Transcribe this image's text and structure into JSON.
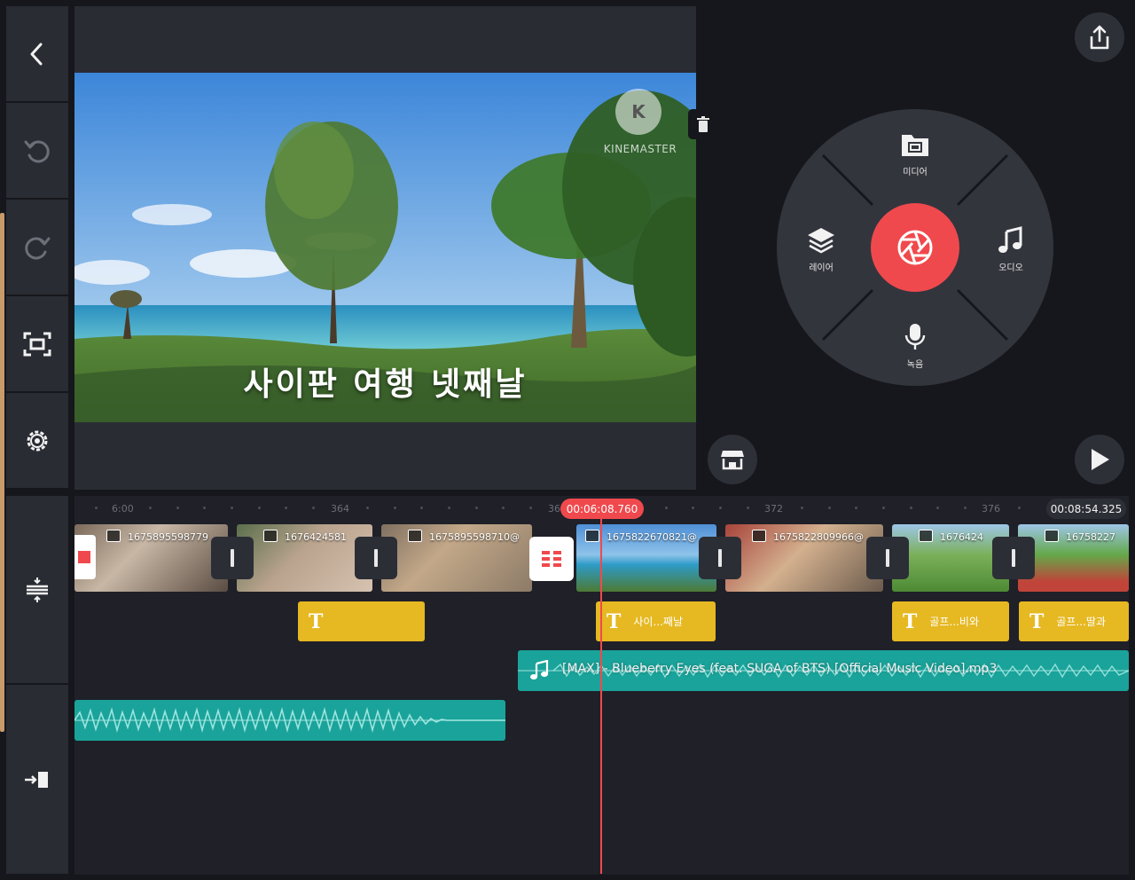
{
  "toolbar": {
    "icons": [
      "back-icon",
      "undo-icon",
      "redo-icon",
      "fit-screen-icon",
      "settings-icon",
      "timeline-expand-icon",
      "jump-to-start-icon"
    ]
  },
  "preview": {
    "title_overlay": "사이판 여행 넷째날",
    "watermark": "KINEMASTER"
  },
  "wheel": {
    "media_label": "미디어",
    "layer_label": "레이어",
    "audio_label": "오디오",
    "record_label": "녹음",
    "accent_color": "#f0494d"
  },
  "timeline": {
    "ruler_labels": [
      "6:00",
      "364",
      "36",
      "372",
      "376"
    ],
    "current_time": "00:06:08.760",
    "total_duration": "00:08:54.325",
    "video_clips": [
      "1675895598779",
      "1676424581",
      "1675895598710@",
      "1675822670821@",
      "1675822809966@",
      "1676424",
      "16758227"
    ],
    "text_clips": [
      "",
      "사이...째날",
      "골프...비와",
      "골프...딸과"
    ],
    "audio_clip_label": "[MAX] - Blueberry Eyes (feat. SUGA of BTS) [Official Music Video].mp3"
  }
}
